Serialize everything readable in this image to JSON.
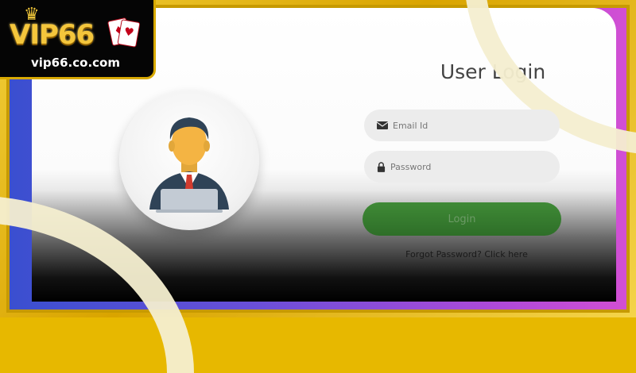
{
  "brand": {
    "logo_text": "VIP66",
    "url": "vip66.co.com",
    "icons": [
      "crown-icon",
      "playing-cards-icon"
    ]
  },
  "login": {
    "title": "User Login",
    "email": {
      "placeholder": "Email Id",
      "icon": "envelope-icon"
    },
    "password": {
      "placeholder": "Password",
      "icon": "lock-icon"
    },
    "button_label": "Login",
    "forgot_text": "Forgot Password? Click here"
  },
  "colors": {
    "frame_gold": "#d9a400",
    "button_green": "#3a7f31",
    "gradient_left": "#3a4fd0",
    "gradient_right": "#d24fd4"
  }
}
